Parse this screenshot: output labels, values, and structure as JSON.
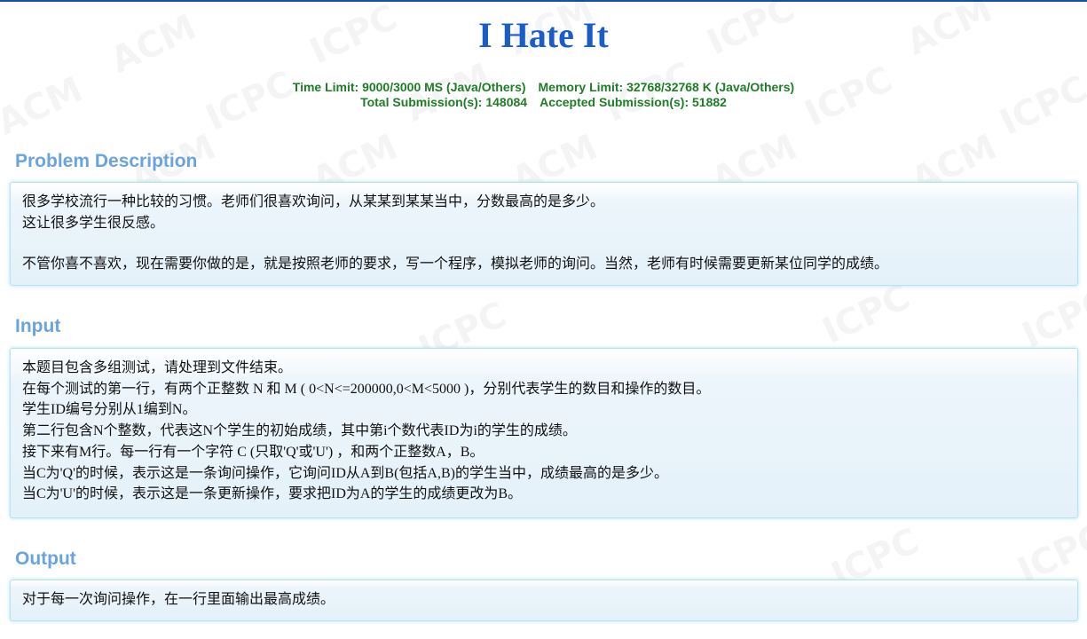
{
  "problem": {
    "title": "I Hate It",
    "time_limit": "Time Limit: 9000/3000 MS (Java/Others)",
    "memory_limit": "Memory Limit: 32768/32768 K (Java/Others)",
    "total_submissions": "Total Submission(s): 148084",
    "accepted_submissions": "Accepted Submission(s): 51882"
  },
  "description": {
    "heading": "Problem Description",
    "lines": [
      "很多学校流行一种比较的习惯。老师们很喜欢询问，从某某到某某当中，分数最高的是多少。",
      "这让很多学生很反感。",
      "不管你喜不喜欢，现在需要你做的是，就是按照老师的要求，写一个程序，模拟老师的询问。当然，老师有时候需要更新某位同学的成绩。"
    ]
  },
  "input": {
    "heading": "Input",
    "lines": [
      "本题目包含多组测试，请处理到文件结束。",
      "在每个测试的第一行，有两个正整数 N 和 M ( 0<N<=200000,0<M<5000 )，分别代表学生的数目和操作的数目。",
      "学生ID编号分别从1编到N。",
      "第二行包含N个整数，代表这N个学生的初始成绩，其中第i个数代表ID为i的学生的成绩。",
      "接下来有M行。每一行有一个字符 C (只取'Q'或'U') ，和两个正整数A，B。",
      "当C为'Q'的时候，表示这是一条询问操作，它询问ID从A到B(包括A,B)的学生当中，成绩最高的是多少。",
      "当C为'U'的时候，表示这是一条更新操作，要求把ID为A的学生的成绩更改为B。"
    ]
  },
  "output": {
    "heading": "Output",
    "lines": [
      "对于每一次询问操作，在一行里面输出最高成绩。"
    ]
  },
  "watermark": {
    "words": [
      "ACM",
      "ICPC"
    ]
  }
}
